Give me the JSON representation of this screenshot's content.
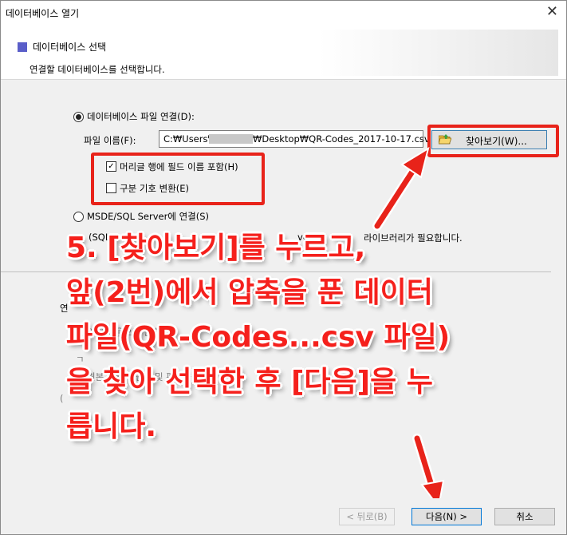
{
  "window": {
    "title": "데이터베이스 열기",
    "close_glyph": "✕"
  },
  "header": {
    "title": "데이터베이스 선택",
    "subtitle": "연결할 데이터베이스를 선택합니다."
  },
  "file_connect": {
    "radio_label": "데이터베이스 파일 연결(D):",
    "filename_label": "파일 이름(F):",
    "path_prefix": "C:₩Users₩",
    "path_suffix": "₩Desktop₩QR-Codes_2017-10-17.csv",
    "browse_label": "찾아보기(W)...",
    "header_checkbox_label": "머리글 행에 필드 이름 포함(H)",
    "header_checkbox_checked": true,
    "delimiter_checkbox_label": "구분 기호 변환(E)",
    "delimiter_checkbox_checked": false
  },
  "msde": {
    "radio_label": "MSDE/SQL Server에 연결(S)",
    "note_start": "(SQL",
    "note_mid": "ver",
    "note_end": "라이브러리가 필요합니다."
  },
  "lower": {
    "section_start": "연",
    "radio1": "읽기 전용으로 연결(R)",
    "radio2": "원본 파일에 연결 및 편집 허용(O)",
    "stub": "(",
    "stub2": "ㄱ"
  },
  "annotation": "5. [찾아보기]를 누르고,\n앞(2번)에서 압축을 푼 데이터\n파일(QR-Codes...csv 파일)\n을 찾아 선택한 후 [다음]을 누\n릅니다.",
  "footer": {
    "back_label": "< 뒤로(B)",
    "next_label": "다음(N) >",
    "cancel_label": "취소"
  },
  "colors": {
    "annotation_red": "#f5201c",
    "header_square": "#5a5ec9"
  }
}
